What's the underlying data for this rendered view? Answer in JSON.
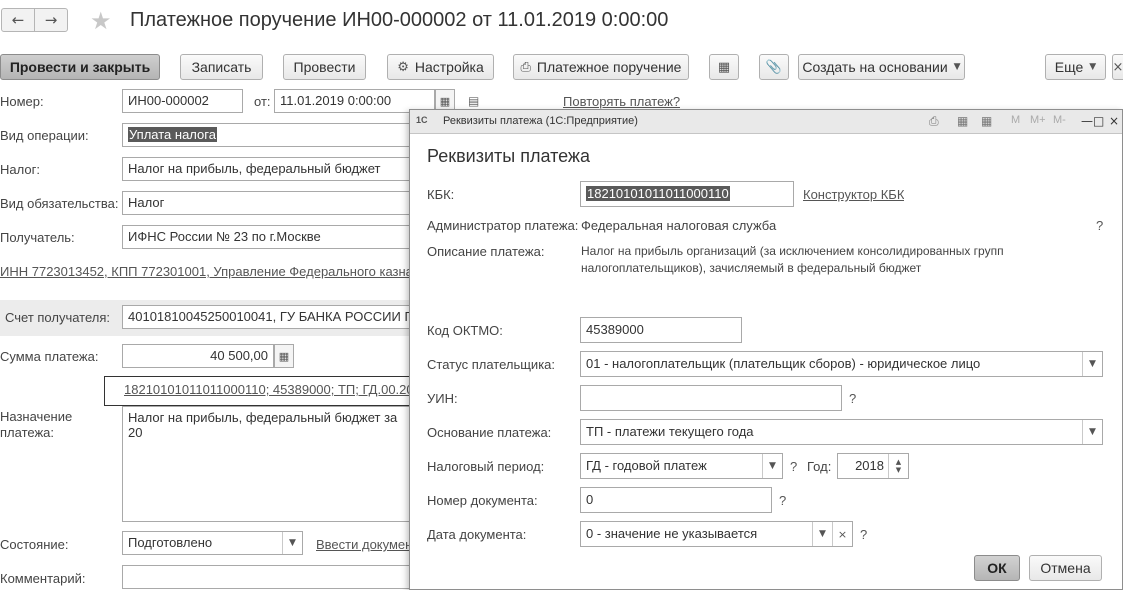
{
  "header": {
    "back_icon": "arrow-left-icon",
    "forward_icon": "arrow-right-icon",
    "favorite_icon": "star-icon",
    "title": "Платежное поручение ИН00-000002 от 11.01.2019 0:00:00"
  },
  "toolbar": {
    "post_close": "Провести и закрыть",
    "save": "Записать",
    "post": "Провести",
    "settings": "Настройка",
    "print": "Платежное поручение",
    "create_based": "Создать на основании",
    "more": "Еще"
  },
  "form": {
    "number_label": "Номер:",
    "number_value": "ИН00-000002",
    "date_label": "от:",
    "date_value": "11.01.2019  0:00:00",
    "repeat_link": "Повторять платеж?",
    "operation_label": "Вид операции:",
    "operation_value": "Уплата налога",
    "tax_label": "Налог:",
    "tax_value": "Налог на прибыль, федеральный бюджет",
    "obligation_label": "Вид обязательства:",
    "obligation_value": "Налог",
    "recipient_label": "Получатель:",
    "recipient_value": "ИФНС России № 23 по г.Москве",
    "recipient_link": "ИНН 7723013452, КПП 772301001, Управление Федерального казна",
    "account_label": "Счет получателя:",
    "account_value": "40101810045250010041, ГУ БАНКА РОССИИ П",
    "amount_label": "Сумма платежа:",
    "amount_value": "40 500,00",
    "kbk_link": "18210101011011000110; 45389000; ТП; ГД.00.20",
    "purpose_label_1": "Назначение",
    "purpose_label_2": "платежа:",
    "purpose_value": "Налог на прибыль, федеральный бюджет за 20",
    "state_label": "Состояние:",
    "state_value": "Подготовлено",
    "enter_doc_link": "Ввести докумен",
    "comment_label": "Комментарий:"
  },
  "modal": {
    "window_title": "Реквизиты платежа  (1С:Предприятие)",
    "heading": "Реквизиты платежа",
    "kbk_label": "КБК:",
    "kbk_value": "18210101011011000110",
    "kbk_constructor": "Конструктор КБК",
    "admin_label": "Администратор платежа:",
    "admin_value": "Федеральная налоговая служба",
    "desc_label": "Описание платежа:",
    "desc_line1": "Налог на прибыль организаций (за исключением консолидированных групп",
    "desc_line2": "налогоплательщиков), зачисляемый в федеральный бюджет",
    "oktmo_label": "Код ОКТМО:",
    "oktmo_value": "45389000",
    "payer_status_label": "Статус плательщика:",
    "payer_status_value": "01 - налогоплательщик (плательщик сборов) - юридическое лицо",
    "uin_label": "УИН:",
    "uin_value": "",
    "basis_label": "Основание платежа:",
    "basis_value": "ТП - платежи текущего года",
    "period_label": "Налоговый период:",
    "period_value": "ГД - годовой платеж",
    "year_label": "Год:",
    "year_value": "2018",
    "docnum_label": "Номер документа:",
    "docnum_value": "0",
    "docdate_label": "Дата документа:",
    "docdate_value": "0 - значение не указывается",
    "question": "?",
    "ok": "ОК",
    "cancel": "Отмена",
    "toolbar_m": "M",
    "toolbar_mplus": "M+",
    "toolbar_mminus": "M-"
  }
}
